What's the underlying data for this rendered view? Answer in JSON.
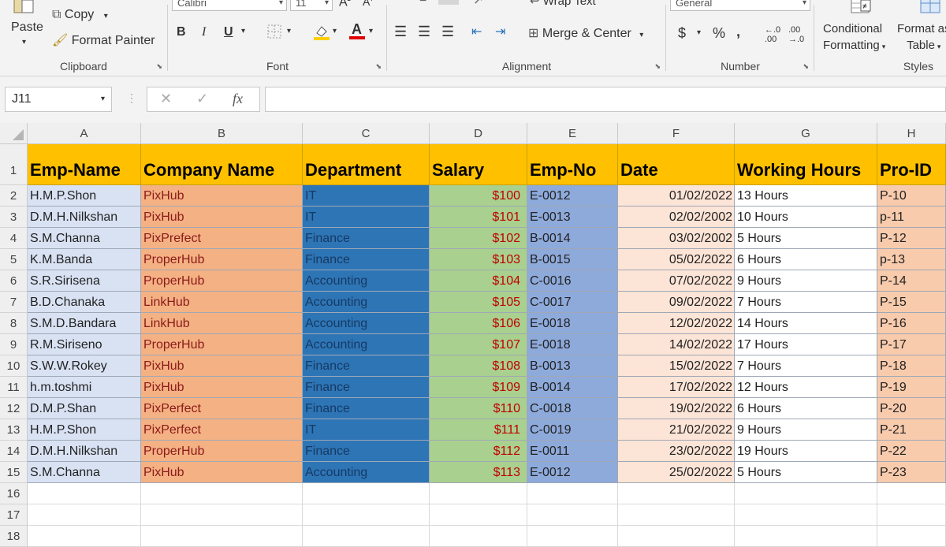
{
  "ribbon": {
    "clipboard": {
      "paste": "Paste",
      "copy": "Copy",
      "format_painter": "Format Painter",
      "label": "Clipboard"
    },
    "font": {
      "font_name": "Calibri",
      "font_size": "11",
      "bold": "B",
      "italic": "I",
      "underline": "U",
      "label": "Font"
    },
    "alignment": {
      "wrap_text": "Wrap Text",
      "merge_center": "Merge & Center",
      "label": "Alignment"
    },
    "number": {
      "format": "General",
      "currency": "$",
      "percent": "%",
      "comma": ",",
      "label": "Number"
    },
    "styles": {
      "conditional_1": "Conditional",
      "conditional_2": "Formatting",
      "format_table_1": "Format as",
      "format_table_2": "Table",
      "label": "Styles"
    }
  },
  "formula_bar": {
    "name_box": "J11",
    "fx": "fx",
    "formula": ""
  },
  "columns": [
    "A",
    "B",
    "C",
    "D",
    "E",
    "F",
    "G",
    "H"
  ],
  "headers": [
    "Emp-Name",
    "Company Name",
    "Department",
    "Salary",
    "Emp-No",
    "Date",
    "Working Hours",
    "Pro-ID"
  ],
  "rows": [
    [
      "H.M.P.Shon",
      "PixHub",
      "IT",
      "$100",
      "E-0012",
      "01/02/2022",
      "13 Hours",
      "P-10"
    ],
    [
      "D.M.H.Nilkshan",
      "PixHub",
      "IT",
      "$101",
      "E-0013",
      "02/02/2002",
      "10 Hours",
      "p-11"
    ],
    [
      "S.M.Channa",
      "PixPrefect",
      "Finance",
      "$102",
      "B-0014",
      "03/02/2002",
      "5 Hours",
      "P-12"
    ],
    [
      "K.M.Banda",
      "ProperHub",
      "Finance",
      "$103",
      "B-0015",
      "05/02/2022",
      "6 Hours",
      "p-13"
    ],
    [
      "S.R.Sirisena",
      "ProperHub",
      "Accounting",
      "$104",
      "C-0016",
      "07/02/2022",
      "9 Hours",
      "P-14"
    ],
    [
      "B.D.Chanaka",
      "LinkHub",
      "Accounting",
      "$105",
      "C-0017",
      "09/02/2022",
      "7 Hours",
      "P-15"
    ],
    [
      "S.M.D.Bandara",
      "LinkHub",
      "Accounting",
      "$106",
      "E-0018",
      "12/02/2022",
      "14 Hours",
      "P-16"
    ],
    [
      "R.M.Siriseno",
      "ProperHub",
      "Accounting",
      "$107",
      "E-0018",
      "14/02/2022",
      "17 Hours",
      "P-17"
    ],
    [
      "S.W.W.Rokey",
      "PixHub",
      "Finance",
      "$108",
      "B-0013",
      "15/02/2022",
      "7  Hours",
      "P-18"
    ],
    [
      "h.m.toshmi",
      "PixHub",
      "Finance",
      "$109",
      "B-0014",
      "17/02/2022",
      "12  Hours",
      "P-19"
    ],
    [
      "D.M.P.Shan",
      "PixPerfect",
      "Finance",
      "$110",
      "C-0018",
      "19/02/2022",
      "6  Hours",
      "P-20"
    ],
    [
      "H.M.P.Shon",
      "PixPerfect",
      "IT",
      "$111",
      "C-0019",
      "21/02/2022",
      "9 Hours",
      "P-21"
    ],
    [
      "D.M.H.Nilkshan",
      "ProperHub",
      "Finance",
      "$112",
      "E-0011",
      "23/02/2022",
      "19 Hours",
      "P-22"
    ],
    [
      "S.M.Channa",
      "PixHub",
      "Accounting",
      "$113",
      "E-0012",
      "25/02/2022",
      "5 Hours",
      "P-23"
    ]
  ],
  "row_numbers": [
    "1",
    "2",
    "3",
    "4",
    "5",
    "6",
    "7",
    "8",
    "9",
    "10",
    "11",
    "12",
    "13",
    "14",
    "15",
    "16",
    "17",
    "18"
  ],
  "colors": {
    "header_fill": "#ffc000",
    "dept_fill": "#2e75b6",
    "salary_fill": "#a9d08e",
    "salary_text": "#c00000"
  }
}
